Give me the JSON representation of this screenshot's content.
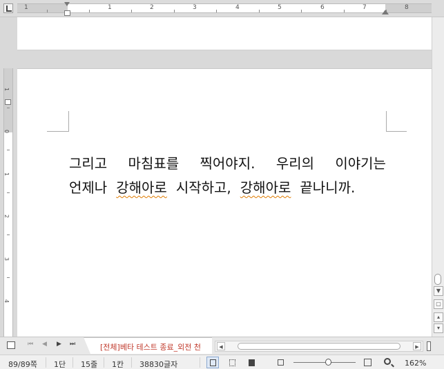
{
  "ruler": {
    "numbers": [
      "1",
      "1",
      "2",
      "3",
      "4",
      "5",
      "6",
      "7",
      "8"
    ],
    "vertical_numbers": [
      "1",
      "0",
      "1",
      "2",
      "3",
      "4"
    ]
  },
  "document": {
    "lines": [
      [
        "그리고",
        "마침표를",
        "찍어야지.",
        "우리의",
        "이야기는"
      ],
      [
        "언제나",
        "강해아로",
        "시작하고,",
        "강해아로",
        "끝나니까."
      ]
    ],
    "misspelled": [
      "강해아로"
    ]
  },
  "tabs": {
    "active_label": "[전체]베타 테스트 종료_외전 천"
  },
  "status": {
    "page": "89/89쪽",
    "section": "1단",
    "line": "15줄",
    "column": "1칸",
    "chars": "38830글자",
    "zoom": "162%"
  },
  "icons": {
    "ruler_corner": "tab-stop-icon",
    "tab_nav": [
      "first-page-icon",
      "prev-page-icon",
      "next-page-icon",
      "last-page-icon"
    ],
    "views": [
      "page-view-icon",
      "width-view-icon",
      "full-view-icon"
    ],
    "zoom": [
      "zoom-out-icon",
      "zoom-in-icon",
      "zoom-search-icon"
    ]
  }
}
